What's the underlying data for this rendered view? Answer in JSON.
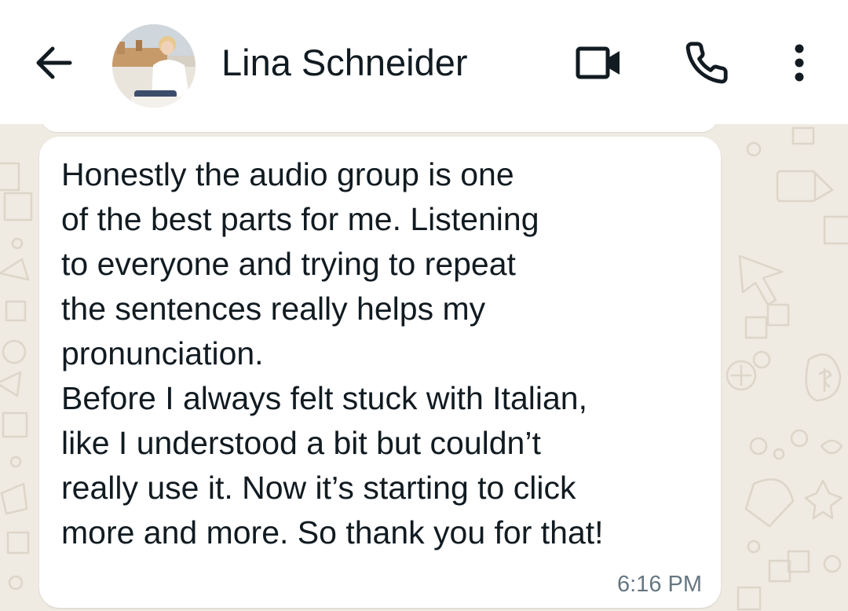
{
  "header": {
    "back_icon": "arrow-left-icon",
    "contact_name": "Lina Schneider",
    "avatar": "contact-photo",
    "actions": {
      "video_icon": "video-camera-icon",
      "call_icon": "phone-icon",
      "menu_icon": "more-vertical-icon"
    }
  },
  "message": {
    "text": "Honestly the audio group is one\nof the best parts for me. Listening\nto everyone and trying to repeat\nthe sentences really helps my\npronunciation.\nBefore I always felt stuck with Italian,\nlike I understood a bit but couldn’t\nreally use it. Now it’s starting to click\nmore and more. So thank you for that!",
    "time": "6:16 PM"
  },
  "colors": {
    "header_bg": "#ffffff",
    "chat_bg": "#efeae2",
    "bubble_bg": "#ffffff",
    "text": "#111b21",
    "timestamp": "#667781"
  }
}
